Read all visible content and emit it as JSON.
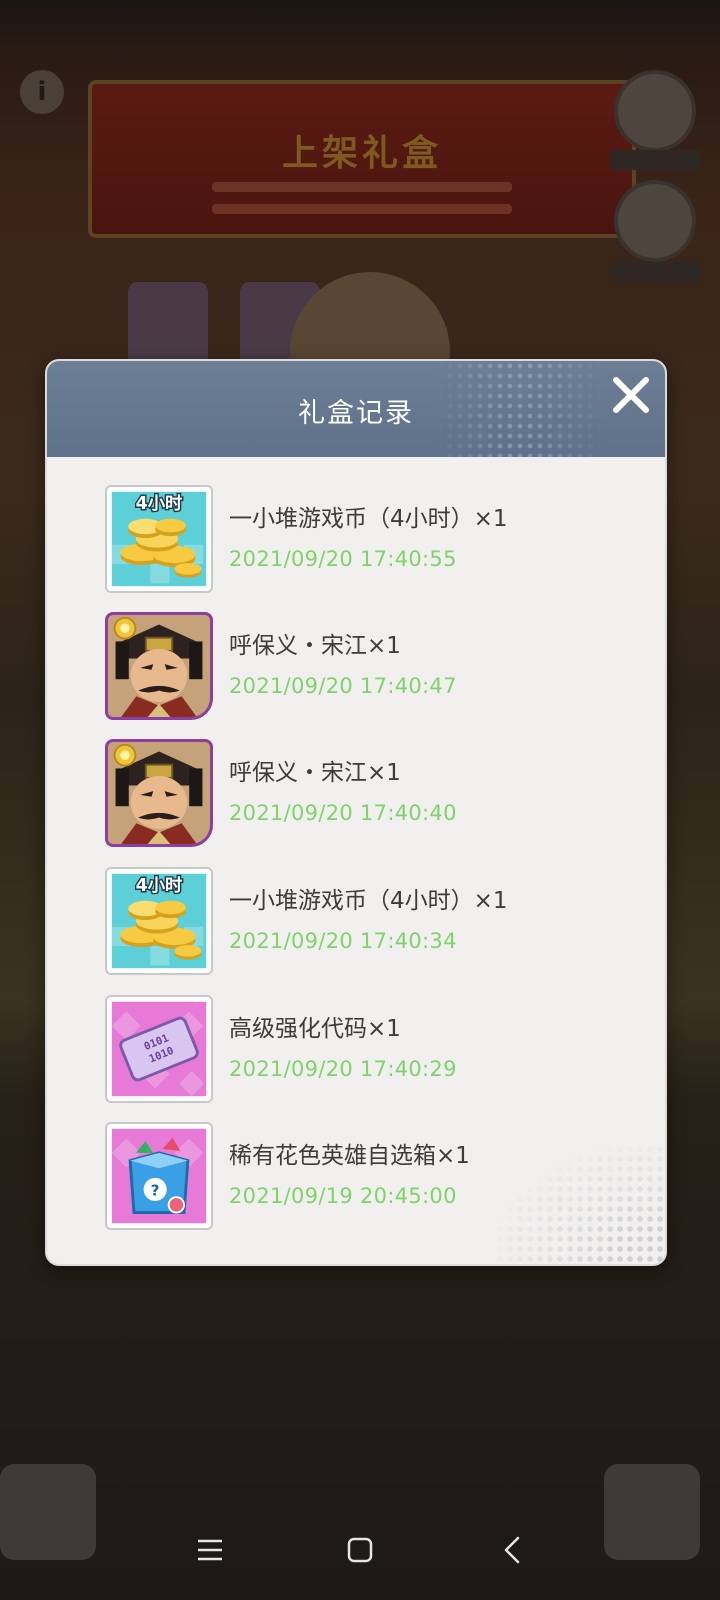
{
  "background": {
    "banner_title": "上架礼盒"
  },
  "dialog": {
    "title": "礼盒记录",
    "close_label": "✕",
    "records": [
      {
        "name": "一小堆游戏币（4小时）×1",
        "time": "2021/09/20 17:40:55",
        "icon": "coin-pile-4h",
        "badge": "4小时"
      },
      {
        "name": "呼保义・宋江×1",
        "time": "2021/09/20 17:40:47",
        "icon": "hero-song-jiang"
      },
      {
        "name": "呼保义・宋江×1",
        "time": "2021/09/20 17:40:40",
        "icon": "hero-song-jiang"
      },
      {
        "name": "一小堆游戏币（4小时）×1",
        "time": "2021/09/20 17:40:34",
        "icon": "coin-pile-4h",
        "badge": "4小时"
      },
      {
        "name": "高级强化代码×1",
        "time": "2021/09/20 17:40:29",
        "icon": "upgrade-code-card"
      },
      {
        "name": "稀有花色英雄自选箱×1",
        "time": "2021/09/19 20:45:00",
        "icon": "mystery-hero-box"
      }
    ]
  },
  "colors": {
    "header": "#6d7f95",
    "panel": "#f1f0ef",
    "timestamp": "#7ed36a",
    "item_text": "#3e3b39"
  },
  "navbar": {
    "buttons": [
      "menu-icon",
      "home-icon",
      "back-icon"
    ]
  }
}
